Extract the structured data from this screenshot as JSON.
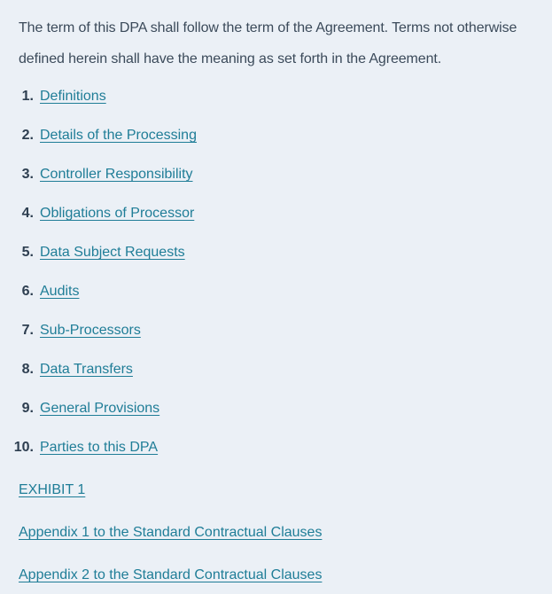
{
  "intro": "The term of this DPA shall follow the term of the Agreement. Terms not otherwise defined herein shall have the meaning as set forth in the Agreement.",
  "toc": [
    {
      "num": "1.",
      "label": "Definitions"
    },
    {
      "num": "2.",
      "label": "Details of the Processing"
    },
    {
      "num": "3.",
      "label": "Controller Responsibility"
    },
    {
      "num": "4.",
      "label": "Obligations of Processor"
    },
    {
      "num": "5.",
      "label": "Data Subject Requests"
    },
    {
      "num": "6.",
      "label": "Audits"
    },
    {
      "num": "7.",
      "label": "Sub-Processors"
    },
    {
      "num": "8.",
      "label": "Data Transfers"
    },
    {
      "num": "9.",
      "label": "General Provisions"
    },
    {
      "num": "10.",
      "label": "Parties to this DPA"
    }
  ],
  "extras": [
    "EXHIBIT 1",
    "Appendix 1 to the Standard Contractual Clauses",
    "Appendix 2 to the Standard Contractual Clauses"
  ],
  "colors": {
    "link": "#1f7d97",
    "text": "#33475b",
    "background": "#ebf0f6"
  }
}
